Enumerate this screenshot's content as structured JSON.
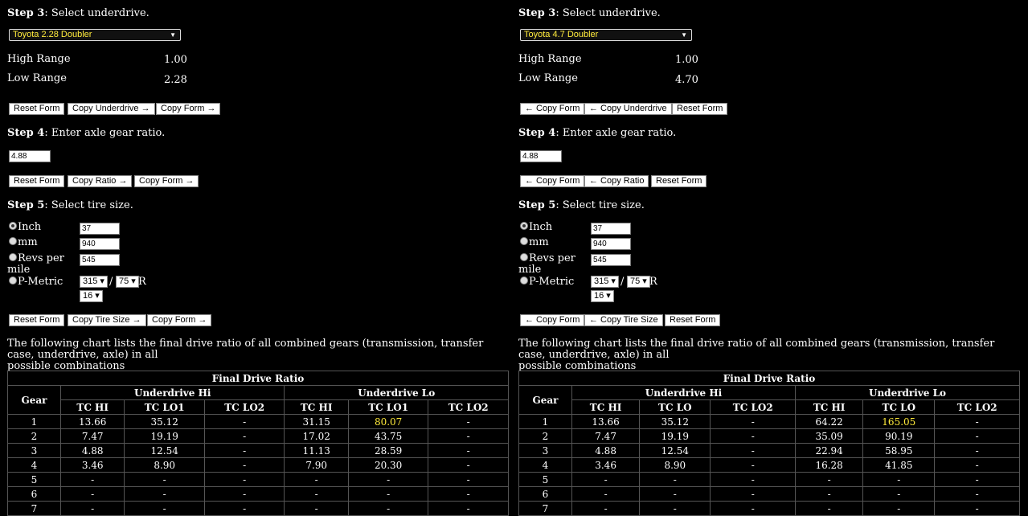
{
  "panels": [
    {
      "step3": {
        "bold": "Step 3",
        "rest": ": Select underdrive."
      },
      "underdrive_select": "Toyota 2.28 Doubler",
      "high_range_label": "High Range",
      "high_range_value": "1.00",
      "low_range_label": "Low Range",
      "low_range_value": "2.28",
      "buttons1": [
        "Reset Form",
        "Copy Underdrive →",
        "Copy Form →"
      ],
      "step4": {
        "bold": "Step 4",
        "rest": ": Enter axle gear ratio."
      },
      "axle_ratio": "4.88",
      "buttons2": [
        "Reset Form",
        "Copy Ratio →",
        "Copy Form →"
      ],
      "step5": {
        "bold": "Step 5",
        "rest": ": Select tire size."
      },
      "tire": {
        "inch_label": "Inch",
        "inch_value": "37",
        "mm_label": "mm",
        "mm_value": "940",
        "revs_label_1": "Revs per",
        "revs_label_2": "mile",
        "revs_value": "545",
        "pmetric_label": "P-Metric",
        "width": "315",
        "slash": "/",
        "aspect": "75",
        "r": "R",
        "rim": "16"
      },
      "buttons3": [
        "Reset Form",
        "Copy Tire Size →",
        "Copy Form →"
      ],
      "description_1": "The following chart lists the final drive ratio of all combined gears (transmission, transfer case, underdrive, axle) in all",
      "description_2": "possible combinations",
      "table": {
        "title": "Final Drive Ratio",
        "gear_header": "Gear",
        "group_hi": "Underdrive Hi",
        "group_lo": "Underdrive Lo",
        "cols": [
          "TC HI",
          "TC LO1",
          "TC LO2",
          "TC HI",
          "TC LO1",
          "TC LO2"
        ],
        "rows": [
          [
            "1",
            "13.66",
            "35.12",
            "-",
            "31.15",
            "80.07",
            "-"
          ],
          [
            "2",
            "7.47",
            "19.19",
            "-",
            "17.02",
            "43.75",
            "-"
          ],
          [
            "3",
            "4.88",
            "12.54",
            "-",
            "11.13",
            "28.59",
            "-"
          ],
          [
            "4",
            "3.46",
            "8.90",
            "-",
            "7.90",
            "20.30",
            "-"
          ],
          [
            "5",
            "-",
            "-",
            "-",
            "-",
            "-",
            "-"
          ],
          [
            "6",
            "-",
            "-",
            "-",
            "-",
            "-",
            "-"
          ],
          [
            "7",
            "-",
            "-",
            "-",
            "-",
            "-",
            "-"
          ]
        ],
        "highlight_color": "#ffeb3b"
      }
    },
    {
      "step3": {
        "bold": "Step 3",
        "rest": ": Select underdrive."
      },
      "underdrive_select": "Toyota 4.7 Doubler",
      "high_range_label": "High Range",
      "high_range_value": "1.00",
      "low_range_label": "Low Range",
      "low_range_value": "4.70",
      "buttons1": [
        "← Copy Form",
        "← Copy Underdrive",
        "Reset Form"
      ],
      "step4": {
        "bold": "Step 4",
        "rest": ": Enter axle gear ratio."
      },
      "axle_ratio": "4.88",
      "buttons2": [
        "← Copy Form",
        "← Copy Ratio",
        "Reset Form"
      ],
      "step5": {
        "bold": "Step 5",
        "rest": ": Select tire size."
      },
      "tire": {
        "inch_label": "Inch",
        "inch_value": "37",
        "mm_label": "mm",
        "mm_value": "940",
        "revs_label_1": "Revs per",
        "revs_label_2": "mile",
        "revs_value": "545",
        "pmetric_label": "P-Metric",
        "width": "315",
        "slash": "/",
        "aspect": "75",
        "r": "R",
        "rim": "16"
      },
      "buttons3": [
        "← Copy Form",
        "← Copy Tire Size",
        "Reset Form"
      ],
      "description_1": "The following chart lists the final drive ratio of all combined gears (transmission, transfer case, underdrive, axle) in all",
      "description_2": "possible combinations",
      "table": {
        "title": "Final Drive Ratio",
        "gear_header": "Gear",
        "group_hi": "Underdrive Hi",
        "group_lo": "Underdrive Lo",
        "cols": [
          "TC HI",
          "TC LO",
          "TC LO2",
          "TC HI",
          "TC LO",
          "TC LO2"
        ],
        "rows": [
          [
            "1",
            "13.66",
            "35.12",
            "-",
            "64.22",
            "165.05",
            "-"
          ],
          [
            "2",
            "7.47",
            "19.19",
            "-",
            "35.09",
            "90.19",
            "-"
          ],
          [
            "3",
            "4.88",
            "12.54",
            "-",
            "22.94",
            "58.95",
            "-"
          ],
          [
            "4",
            "3.46",
            "8.90",
            "-",
            "16.28",
            "41.85",
            "-"
          ],
          [
            "5",
            "-",
            "-",
            "-",
            "-",
            "-",
            "-"
          ],
          [
            "6",
            "-",
            "-",
            "-",
            "-",
            "-",
            "-"
          ],
          [
            "7",
            "-",
            "-",
            "-",
            "-",
            "-",
            "-"
          ]
        ],
        "highlight_color": "#ffeb3b"
      }
    }
  ]
}
